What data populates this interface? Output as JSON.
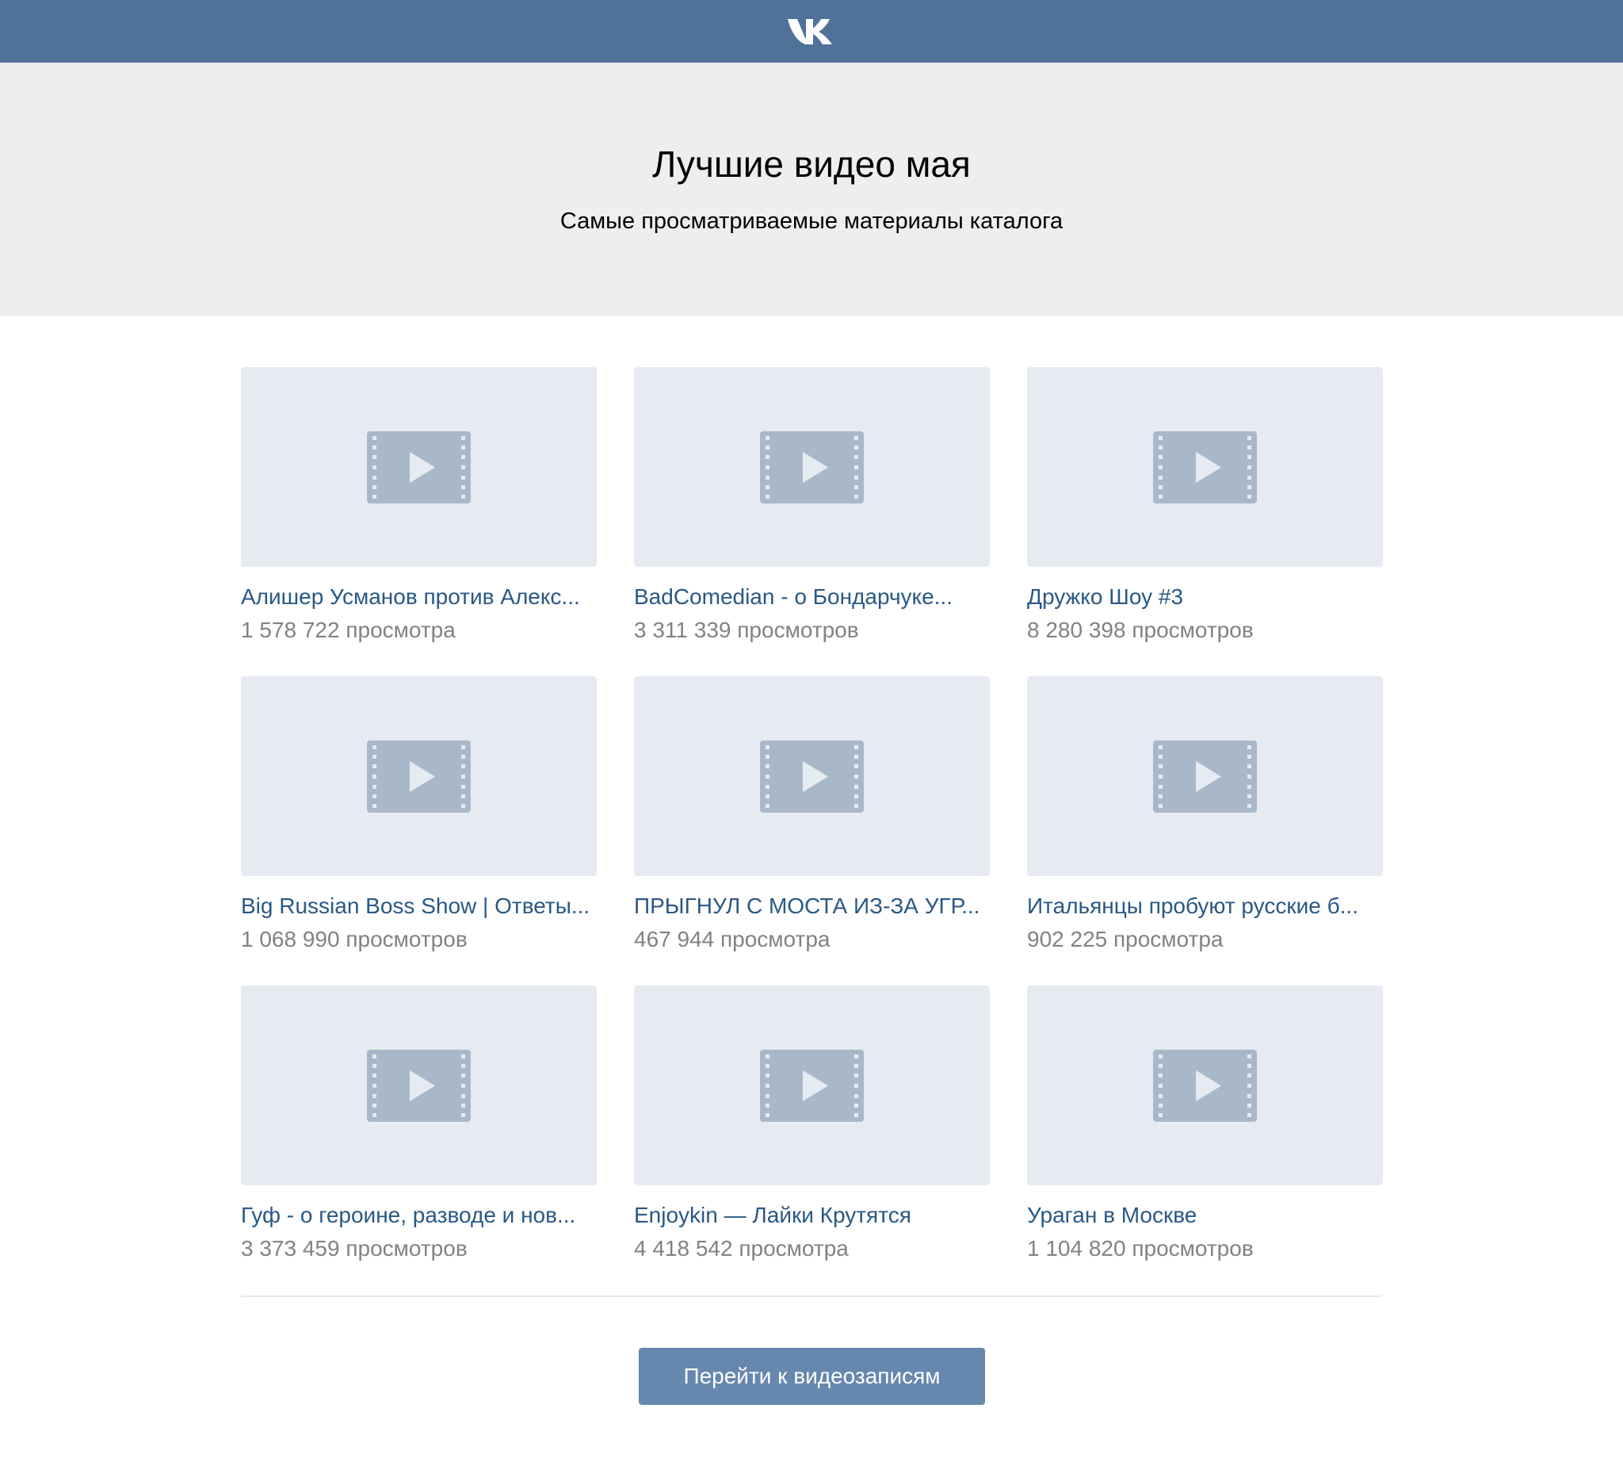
{
  "header": {
    "logo_icon": "vk-logo-icon",
    "bar_color": "#507299"
  },
  "hero": {
    "title": "Лучшие видео мая",
    "subtitle": "Самые просматриваемые материалы каталога"
  },
  "videos": [
    {
      "title": "Алишер Усманов против Алекс...",
      "views": "1 578 722 просмотра",
      "icon": "video-placeholder-icon"
    },
    {
      "title": "BadComedian - о Бондарчуке...",
      "views": "3 311 339 просмотров",
      "icon": "video-placeholder-icon"
    },
    {
      "title": "Дружко Шоу #3",
      "views": "8 280 398 просмотров",
      "icon": "video-placeholder-icon"
    },
    {
      "title": "Big Russian Boss Show | Ответы...",
      "views": "1 068 990 просмотров",
      "icon": "video-placeholder-icon"
    },
    {
      "title": "ПРЫГНУЛ С МОСТА ИЗ-ЗА УГР...",
      "views": "467 944 просмотра",
      "icon": "video-placeholder-icon"
    },
    {
      "title": "Итальянцы пробуют русские б...",
      "views": "902 225 просмотра",
      "icon": "video-placeholder-icon"
    },
    {
      "title": "Гуф - о героине, разводе и нов...",
      "views": "3 373 459 просмотров",
      "icon": "video-placeholder-icon"
    },
    {
      "title": "Enjoykin — Лайки Крутятся",
      "views": "4 418 542 просмотра",
      "icon": "video-placeholder-icon"
    },
    {
      "title": "Ураган в Москве",
      "views": "1 104 820 просмотров",
      "icon": "video-placeholder-icon"
    }
  ],
  "footer": {
    "cta_label": "Перейти к видеозаписям",
    "cta_color": "#6687ae"
  },
  "colors": {
    "link": "#2a5885",
    "muted": "#828282",
    "thumb_bg": "#e5ebf1",
    "thumb_icon": "#a9b8c8",
    "hero_bg": "#edeef0"
  }
}
